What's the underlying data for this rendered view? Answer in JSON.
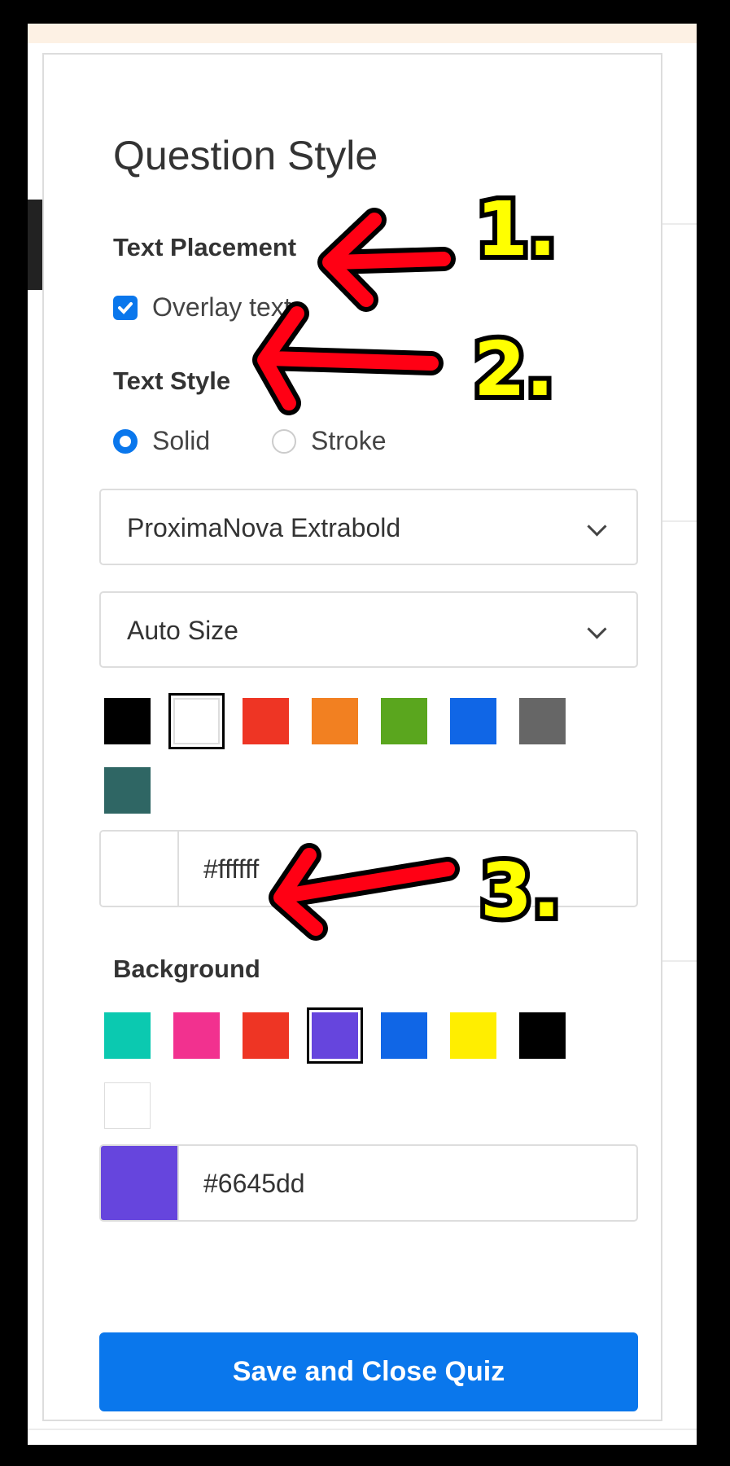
{
  "panel": {
    "title": "Question Style",
    "text_placement": {
      "label": "Text Placement",
      "overlay_label": "Overlay text",
      "overlay_checked": true
    },
    "text_style": {
      "label": "Text Style",
      "options": [
        "Solid",
        "Stroke"
      ],
      "selected": "Solid"
    },
    "font_select": {
      "value": "ProximaNova Extrabold",
      "icon": "chevron-down-icon"
    },
    "size_select": {
      "value": "Auto Size",
      "icon": "chevron-down-icon"
    },
    "text_colors": [
      "#000000",
      "#ffffff",
      "#ee3524",
      "#f28021",
      "#5aa61e",
      "#1066e6",
      "#666666",
      "#2f6664"
    ],
    "text_color_selected": "#ffffff",
    "text_hex": "#ffffff",
    "background": {
      "label": "Background",
      "colors": [
        "#0bc9b0",
        "#f2318f",
        "#ee3524",
        "#6645dd",
        "#1066e6",
        "#ffee00",
        "#000000",
        "#ffffff"
      ],
      "selected": "#6645dd",
      "hex": "#6645dd"
    },
    "save_button": "Save and Close Quiz"
  },
  "annotations": {
    "numbers": [
      "1.",
      "2.",
      "3."
    ],
    "arrow_color": "#ff0014",
    "number_color": "#ffff00"
  },
  "colors": {
    "accent": "#0a77ec",
    "top_strip": "#fdf1e4"
  }
}
